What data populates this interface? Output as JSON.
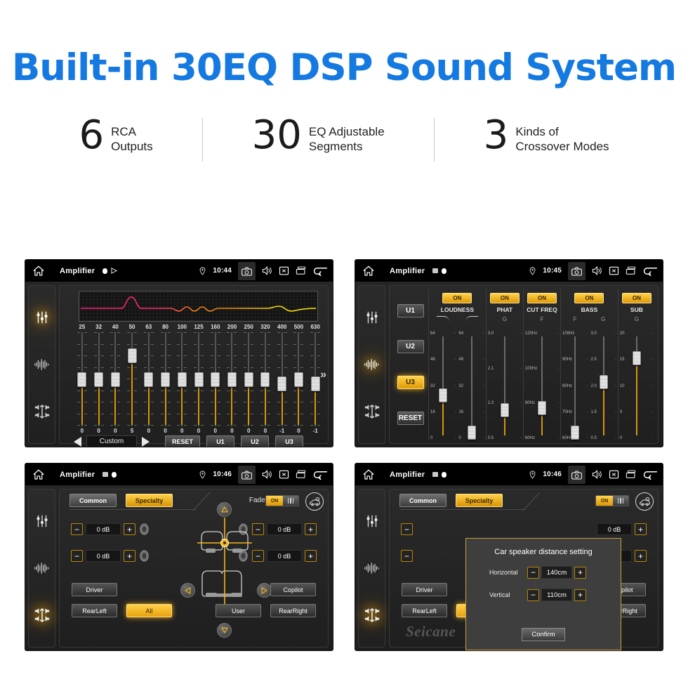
{
  "hero": {
    "title": "Built-in 30EQ DSP Sound System",
    "stats": [
      {
        "num": "6",
        "text": "RCA\nOutputs"
      },
      {
        "num": "30",
        "text": "EQ Adjustable\nSegments"
      },
      {
        "num": "3",
        "text": "Kinds of\nCrossover Modes"
      }
    ]
  },
  "colors": {
    "accent_blue": "#1479e0",
    "amber": "#e0a117",
    "amber_light": "#ffd24d",
    "panel_bg": "#262626",
    "status_bg": "#000000"
  },
  "screens": {
    "eq": {
      "statusbar": {
        "title": "Amplifier",
        "time": "10:44",
        "icons": [
          "home-icon",
          "record-icon",
          "play-icon",
          "location-icon",
          "camera-icon",
          "volume-icon",
          "close-icon",
          "recents-icon",
          "back-icon"
        ]
      },
      "rail": [
        {
          "name": "equalizer-icon",
          "active": true
        },
        {
          "name": "waveform-icon",
          "active": false
        },
        {
          "name": "balance-icon",
          "active": false
        }
      ],
      "graph": {
        "name": "eq-response-curve"
      },
      "bands": [
        {
          "freq": "25",
          "value": "0"
        },
        {
          "freq": "32",
          "value": "0"
        },
        {
          "freq": "40",
          "value": "0"
        },
        {
          "freq": "50",
          "value": "5"
        },
        {
          "freq": "63",
          "value": "0"
        },
        {
          "freq": "80",
          "value": "0"
        },
        {
          "freq": "100",
          "value": "0"
        },
        {
          "freq": "125",
          "value": "0"
        },
        {
          "freq": "160",
          "value": "0"
        },
        {
          "freq": "200",
          "value": "0"
        },
        {
          "freq": "250",
          "value": "0"
        },
        {
          "freq": "320",
          "value": "0"
        },
        {
          "freq": "400",
          "value": "-1"
        },
        {
          "freq": "500",
          "value": "0"
        },
        {
          "freq": "630",
          "value": "-1"
        }
      ],
      "more_label": "»",
      "preset": "Custom",
      "reset_label": "RESET",
      "user_presets": [
        "U1",
        "U2",
        "U3"
      ]
    },
    "crossover": {
      "statusbar": {
        "title": "Amplifier",
        "time": "10:45"
      },
      "rail": [
        {
          "name": "equalizer-icon",
          "active": false
        },
        {
          "name": "waveform-icon",
          "active": true
        },
        {
          "name": "balance-icon",
          "active": false
        }
      ],
      "user_presets": [
        "U1",
        "U2",
        "U3"
      ],
      "active_preset": "U3",
      "reset_label": "RESET",
      "sections": [
        {
          "label": "LOUDNESS",
          "toggle": "ON",
          "sub": [
            "curve-down-icon",
            "curve-up-icon"
          ],
          "columns": [
            {
              "head": "",
              "scale": [
                "64",
                "48",
                "32",
                "16",
                "0"
              ],
              "knob_pct": 38
            },
            {
              "head": "",
              "scale": [
                "64",
                "48",
                "32",
                "16",
                "0"
              ],
              "knob_pct": 3
            }
          ]
        },
        {
          "label": "PHAT",
          "toggle": "ON",
          "sub": [
            "G"
          ],
          "columns": [
            {
              "head": "G",
              "scale": [
                "3.0",
                "2.1",
                "1.3",
                "0.5"
              ],
              "knob_pct": 24
            }
          ]
        },
        {
          "label": "CUT FREQ",
          "toggle": "ON",
          "sub": [
            "F"
          ],
          "columns": [
            {
              "head": "F",
              "scale": [
                "120Hz",
                "100Hz",
                "80Hz",
                "60Hz"
              ],
              "knob_pct": 26
            }
          ]
        },
        {
          "label": "BASS",
          "toggle": "ON",
          "sub": [
            "F",
            "G"
          ],
          "columns": [
            {
              "head": "F",
              "scale": [
                "100Hz",
                "90Hz",
                "80Hz",
                "70Hz",
                "60Hz"
              ],
              "knob_pct": 3
            },
            {
              "head": "G",
              "scale": [
                "3.0",
                "2.5",
                "2.0",
                "1.5",
                "0.5"
              ],
              "knob_pct": 51
            }
          ]
        },
        {
          "label": "SUB",
          "toggle": "ON",
          "sub": [
            "G"
          ],
          "columns": [
            {
              "head": "G",
              "scale": [
                "20",
                "15",
                "10",
                "5",
                "0"
              ],
              "knob_pct": 74
            }
          ]
        }
      ]
    },
    "fader": {
      "statusbar": {
        "title": "Amplifier",
        "time": "10:46"
      },
      "rail": [
        {
          "name": "equalizer-icon",
          "active": false
        },
        {
          "name": "waveform-icon",
          "active": false
        },
        {
          "name": "balance-icon",
          "active": true
        }
      ],
      "tabs": [
        {
          "label": "Common",
          "active": false
        },
        {
          "label": "Specialty",
          "active": true
        }
      ],
      "fader_label": "Fader",
      "fader_toggle": "ON",
      "car_setting_icon": "car-settings-icon",
      "levels": [
        {
          "position": "front-left",
          "value": "0 dB"
        },
        {
          "position": "rear-left",
          "value": "0 dB"
        },
        {
          "position": "front-right",
          "value": "0 dB"
        },
        {
          "position": "rear-right",
          "value": "0 dB"
        }
      ],
      "stepper_minus": "−",
      "stepper_plus": "+",
      "presets": [
        {
          "label": "Driver",
          "active": false
        },
        {
          "label": "Copilot",
          "active": false
        },
        {
          "label": "RearLeft",
          "active": false
        },
        {
          "label": "All",
          "active": true
        },
        {
          "label": "User",
          "active": false
        },
        {
          "label": "RearRight",
          "active": false
        }
      ]
    },
    "dialog": {
      "statusbar": {
        "title": "Amplifier",
        "time": "10:46"
      },
      "title": "Car speaker distance setting",
      "rows": [
        {
          "label": "Horizontal",
          "value": "140cm"
        },
        {
          "label": "Vertical",
          "value": "110cm"
        }
      ],
      "minus": "−",
      "plus": "+",
      "confirm": "Confirm"
    }
  },
  "watermark": "Seicane"
}
